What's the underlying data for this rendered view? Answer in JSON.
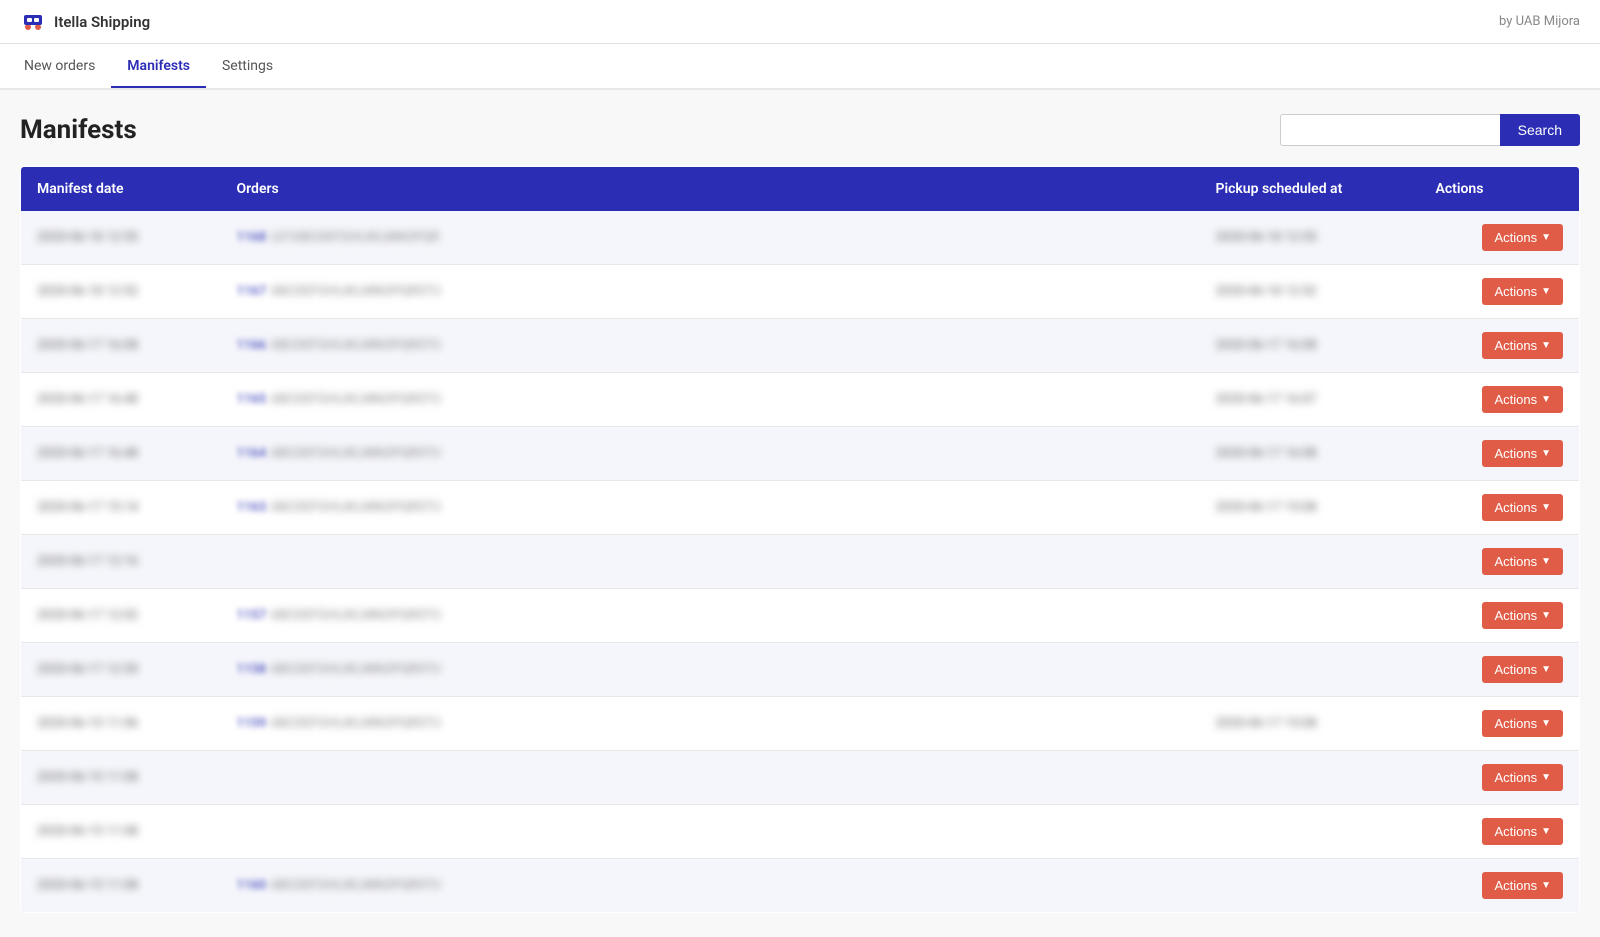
{
  "app": {
    "brand": "Itella Shipping",
    "byline": "by UAB Mijora"
  },
  "nav": {
    "items": [
      {
        "label": "New orders",
        "active": false
      },
      {
        "label": "Manifests",
        "active": true
      },
      {
        "label": "Settings",
        "active": false
      }
    ]
  },
  "page": {
    "title": "Manifests",
    "search_placeholder": "",
    "search_button_label": "Search"
  },
  "table": {
    "columns": [
      {
        "label": "Manifest date"
      },
      {
        "label": "Orders"
      },
      {
        "label": "Pickup scheduled at"
      },
      {
        "label": "Actions"
      }
    ],
    "rows": [
      {
        "date": "2020-06-18 12:55",
        "order_count": "1168",
        "order_desc": "LKTABCDEFGHIJKLMNOPQR",
        "pickup": "2020-06-18 12:55",
        "has_pickup": true
      },
      {
        "date": "2020-06-18 12:52",
        "order_count": "1167",
        "order_desc": "ABCDEFGHIJKLMNOPQRSTU",
        "pickup": "2020-06-18 12:52",
        "has_pickup": true
      },
      {
        "date": "2020-06-17 16:08",
        "order_count": "1166",
        "order_desc": "ABCDEFGHIJKLMNOPQRSTU",
        "pickup": "2020-06-17 16:08",
        "has_pickup": true
      },
      {
        "date": "2020-06-17 16:48",
        "order_count": "1165",
        "order_desc": "ABCDEFGHIJKLMNOPQRSTU",
        "pickup": "2020-06-17 16:07",
        "has_pickup": true
      },
      {
        "date": "2020-06-17 16:48",
        "order_count": "1164",
        "order_desc": "ABCDEFGHIJKLMNOPQRSTU",
        "pickup": "2020-06-17 16:08",
        "has_pickup": true
      },
      {
        "date": "2020-06-17 15:14",
        "order_count": "1163",
        "order_desc": "ABCDEFGHIJKLMNOPQRSTU",
        "pickup": "2020-06-17 15:08",
        "has_pickup": true
      },
      {
        "date": "2020-06-17 12:16",
        "order_count": "",
        "order_desc": "",
        "pickup": "",
        "has_pickup": false
      },
      {
        "date": "2020-06-17 12:02",
        "order_count": "1157",
        "order_desc": "ABCDEFGHIJKLMNOPQRSTU",
        "pickup": "",
        "has_pickup": false
      },
      {
        "date": "2020-06-17 12:30",
        "order_count": "1158",
        "order_desc": "ABCDEFGHIJKLMNOPQRSTU",
        "pickup": "",
        "has_pickup": false
      },
      {
        "date": "2020-06-15 11:06",
        "order_count": "1159",
        "order_desc": "ABCDEFGHIJKLMNOPQRSTU",
        "pickup": "2020-06-17 15:08",
        "has_pickup": true
      },
      {
        "date": "2020-06-15 11:08",
        "order_count": "",
        "order_desc": "",
        "pickup": "",
        "has_pickup": false
      },
      {
        "date": "2020-06-15 11:08",
        "order_count": "",
        "order_desc": "",
        "pickup": "",
        "has_pickup": false
      },
      {
        "date": "2020-06-15 11:08",
        "order_count": "1160",
        "order_desc": "ABCDEFGHIJKLMNOPQRSTU",
        "pickup": "",
        "has_pickup": false
      }
    ],
    "actions_label": "Actions"
  }
}
